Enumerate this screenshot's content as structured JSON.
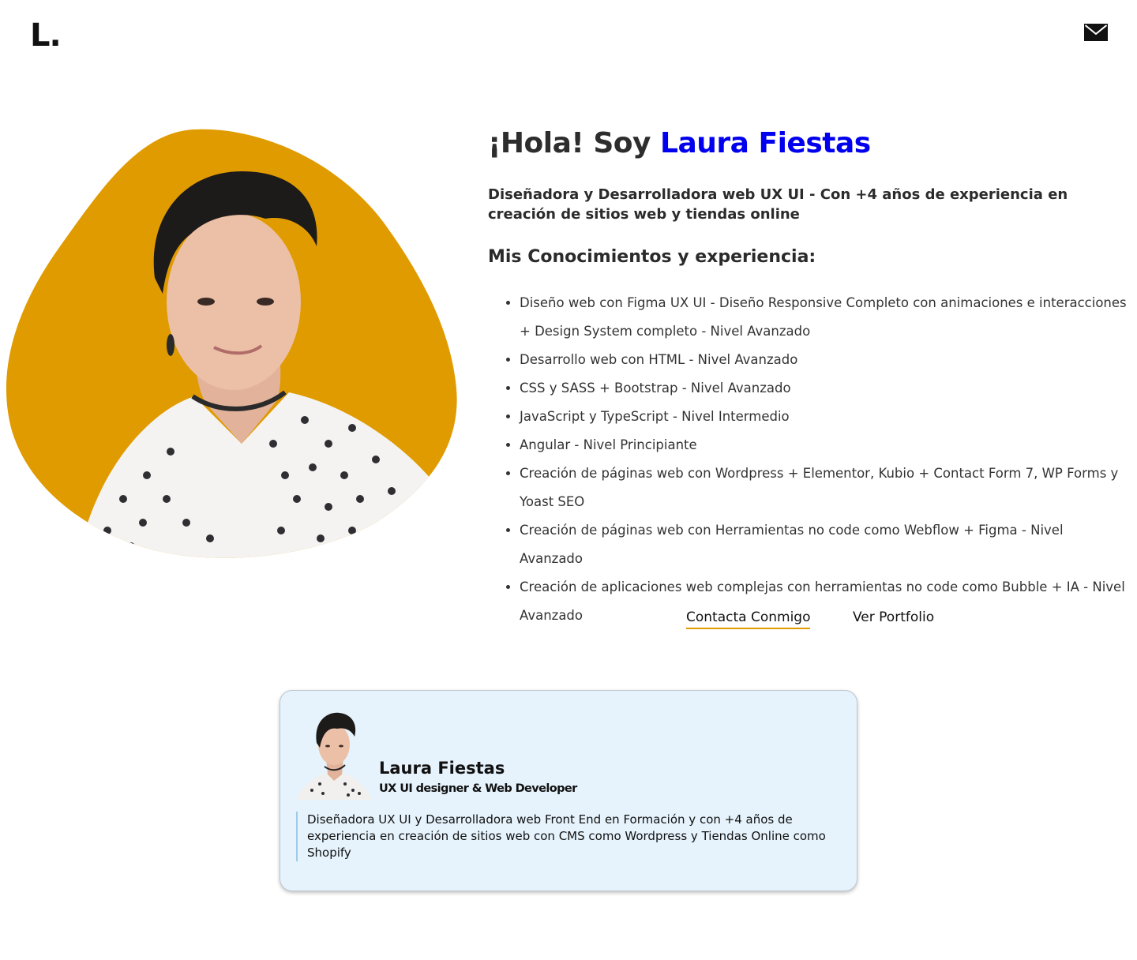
{
  "header": {
    "logo_text": "L.",
    "mail_icon": "envelope-icon"
  },
  "hero": {
    "greeting_prefix": "¡Hola! Soy ",
    "greeting_name": "Laura Fiestas",
    "subtitle": "Diseñadora y Desarrolladora web UX UI - Con +4 años de experiencia en creación de sitios web y tiendas online",
    "section_title": "Mis Conocimientos y experiencia:",
    "skills": [
      "Diseño web con Figma UX UI - Diseño Responsive Completo con animaciones e interacciones + Design System completo - Nivel Avanzado",
      "Desarrollo web con HTML - Nivel Avanzado",
      "CSS y SASS + Bootstrap - Nivel Avanzado",
      "JavaScript y TypeScript - Nivel Intermedio",
      "Angular - Nivel Principiante",
      "Creación de páginas web con Wordpress + Elementor, Kubio + Contact Form 7, WP Forms y Yoast SEO",
      "Creación de páginas web con Herramientas no code como Webflow + Figma - Nivel Avanzado",
      "Creación de aplicaciones web complejas con herramientas no code como Bubble + IA - Nivel Avanzado"
    ],
    "contact_label": "Contacta Conmigo",
    "portfolio_label": "Ver Portfolio",
    "blob_color": "#e09b00",
    "name_color": "#0000ee"
  },
  "card": {
    "name": "Laura Fiestas",
    "role": "UX UI designer & Web Developer",
    "bio": "Diseñadora UX UI y Desarrolladora web Front End en Formación y con +4 años de experiencia en creación de sitios web con CMS como Wordpress y Tiendas Online como Shopify",
    "background": "#e6f3fc"
  }
}
